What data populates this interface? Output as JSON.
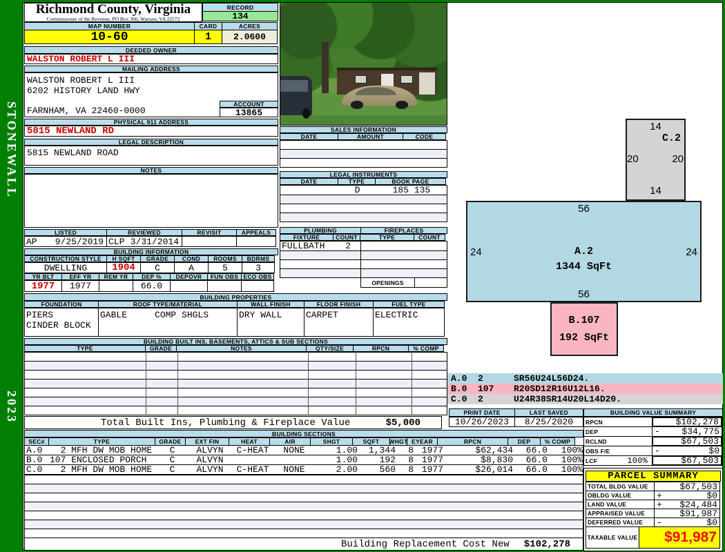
{
  "sidebar": {
    "district": "STONEWALL",
    "year": "2023"
  },
  "header": {
    "county": "Richmond County, Virginia",
    "commissioner": "Commissioner of the Revenue, PO Box 366, Warsaw, VA 22572",
    "record_label": "RECORD",
    "record_value": "134",
    "map_label": "MAP NUMBER",
    "map_value": "10-60",
    "card_label": "CARD",
    "card_value": "1",
    "acres_label": "ACRES",
    "acres_value": "2.0600"
  },
  "owner": {
    "deeded_label": "DEEDED OWNER",
    "deeded_value": "WALSTON ROBERT L III",
    "mailing_label": "MAILING ADDRESS",
    "mailing_lines": [
      "WALSTON ROBERT L III",
      "6202 HISTORY LAND HWY",
      "FARNHAM, VA 22460-0000"
    ],
    "account_label": "ACCOUNT",
    "account_value": "13865",
    "physical_label": "PHYSICAL 911 ADDRESS",
    "physical_value": "5815 NEWLAND RD",
    "legal_label": "LEGAL DESCRIPTION",
    "legal_value": "5815 NEWLAND ROAD",
    "notes_label": "NOTES"
  },
  "visits": {
    "listed_label": "LISTED",
    "listed_code": "AP",
    "listed_date": "9/25/2019",
    "reviewed_label": "REVIEWED",
    "reviewed_code": "CLP",
    "reviewed_date": "3/31/2014",
    "revisit_label": "REVISIT",
    "appeals_label": "APPEALS"
  },
  "building_info": {
    "title": "BUILDING INFORMATION",
    "style_label": "CONSTRUCTION STYLE",
    "style": "DWELLING",
    "hsqft_label": "H SQFT",
    "hsqft": "1904",
    "grade_label": "GRADE",
    "grade": "C",
    "cond_label": "COND",
    "cond": "A",
    "rooms_label": "ROOMS",
    "rooms": "5",
    "bdrms_label": "BDRMS",
    "bdrms": "3",
    "yrblt_label": "YR BLT",
    "yrblt": "1977",
    "effyr_label": "EFF YR",
    "effyr": "1977",
    "remyr_label": "REM YR",
    "remyr": "",
    "dep_label": "DEP %",
    "dep": "66.0",
    "depovr_label": "DEPOVR",
    "depovr": "",
    "funobs_label": "FUN OBS",
    "funobs": "",
    "ecoobs_label": "ECO OBS",
    "ecoobs": ""
  },
  "properties": {
    "title": "BUILDING PROPERTIES",
    "foundation_label": "FOUNDATION",
    "foundation_lines": [
      "PIERS",
      "CINDER BLOCK"
    ],
    "roof_label": "ROOF TYPE/MATERIAL",
    "roof_type": "GABLE",
    "roof_material": "COMP SHGLS",
    "wall_label": "WALL FINISH",
    "wall": "DRY WALL",
    "floor_label": "FLOOR FINISH",
    "floor": "CARPET",
    "fuel_label": "FUEL TYPE",
    "fuel": "ELECTRIC"
  },
  "builtins": {
    "title": "BUILDING BUILT INS, BASEMENTS, ATTICS & SUB SECTIONS",
    "columns": [
      "TYPE",
      "GRADE",
      "NOTES",
      "QTY/SIZE",
      "RPCN",
      "% COMP"
    ],
    "total_label": "Total Built Ins, Plumbing & Fireplace Value",
    "total_value": "$5,000"
  },
  "sales": {
    "title": "SALES INFORMATION",
    "columns": [
      "DATE",
      "AMOUNT",
      "CODE"
    ]
  },
  "instruments": {
    "title": "LEGAL INSTRUMENTS",
    "columns": [
      "DATE",
      "TYPE",
      "BOOK PAGE"
    ],
    "rows": [
      {
        "date": "",
        "type": "D",
        "book_page": "185 135"
      }
    ]
  },
  "plumbing": {
    "title": "PLUMBING",
    "fixture_label": "FIXTURE",
    "count_label": "COUNT",
    "fixture": "FULLBATH",
    "count": "2"
  },
  "fireplaces": {
    "title": "FIREPLACES",
    "type_label": "TYPE",
    "count_label": "COUNT",
    "openings_label": "OPENINGS"
  },
  "sketch": {
    "c2": {
      "name": "C.2",
      "top": "14",
      "left": "20",
      "right": "20",
      "bottom": "14"
    },
    "a2": {
      "name": "A.2",
      "sqft": "1344 SqFt",
      "top": "56",
      "left": "24",
      "right": "24",
      "bottom": "56"
    },
    "b107": {
      "name": "B.107",
      "sqft": "192 SqFt"
    },
    "legend": [
      {
        "sec": "A.0",
        "code": "2",
        "trace": "SR56U24L56D24."
      },
      {
        "sec": "B.0",
        "code": "107",
        "trace": "R20SD12R16U12L16."
      },
      {
        "sec": "C.0",
        "code": "2",
        "trace": "U24R38SR14U20L14D20."
      }
    ],
    "colors": {
      "a": "#b2d8e4",
      "b": "#f9b6c2",
      "c": "#d4d4d4"
    }
  },
  "meta": {
    "print_label": "PRINT DATE",
    "print_date": "10/26/2023",
    "saved_label": "LAST SAVED",
    "last_saved": "8/25/2020"
  },
  "value_summary": {
    "title": "BUILDING VALUE SUMMARY",
    "rows": [
      {
        "label": "RPCN",
        "op": "",
        "value": "$102,278"
      },
      {
        "label": "DEP",
        "op": "-",
        "value": "$34,775"
      },
      {
        "label": "RCLND",
        "op": "",
        "value": "$67,503"
      },
      {
        "label": "OBS F/E",
        "op": "-",
        "value": "$0"
      },
      {
        "label": "LCF",
        "pct": "100%",
        "op": "",
        "value": "$67,503"
      }
    ]
  },
  "sections": {
    "title": "BUILDING SECTIONS",
    "columns": [
      "SEC#",
      "TYPE",
      "GRADE",
      "EXT FIN",
      "HEAT",
      "AIR",
      "SHGT",
      "SQFT",
      "WHGT",
      "EYEAR",
      "RPCN",
      "DEP",
      "% COMP"
    ],
    "rows": [
      {
        "cells": [
          "A.0",
          "  2 MFH DW MOB HOME",
          "C",
          "ALVYN",
          "C-HEAT",
          "NONE",
          "1.00",
          "1,344",
          "8",
          "1977",
          "$62,434",
          "66.0",
          "100%"
        ]
      },
      {
        "cells": [
          "B.0",
          "107 ENCLOSED PORCH",
          "C",
          "ALVYN",
          "",
          "",
          "1.00",
          "192",
          "8",
          "1977",
          "$8,830",
          "66.0",
          "100%"
        ]
      },
      {
        "cells": [
          "C.0",
          "  2 MFH DW MOB HOME",
          "C",
          "ALVYN",
          "C-HEAT",
          "NONE",
          "2.00",
          "560",
          "8",
          "1977",
          "$26,014",
          "66.0",
          "100%"
        ]
      }
    ],
    "replacement_label": "Building Replacement Cost New",
    "replacement_value": "$102,278"
  },
  "parcel_summary": {
    "title": "PARCEL SUMMARY",
    "rows": [
      {
        "label": "TOTAL BLDG VALUE",
        "op": "",
        "value": "$67,503"
      },
      {
        "label": "OBLDG VALUE",
        "op": "+",
        "value": "$0"
      },
      {
        "label": "LAND VALUE",
        "op": "+",
        "value": "$24,484"
      },
      {
        "label": "APPRAISED VALUE",
        "op": "",
        "value": "$91,987"
      },
      {
        "label": "DEFERRED VALUE",
        "op": "-",
        "value": "$0"
      }
    ],
    "taxable_label": "TAXABLE VALUE",
    "taxable_value": "$91,987"
  }
}
